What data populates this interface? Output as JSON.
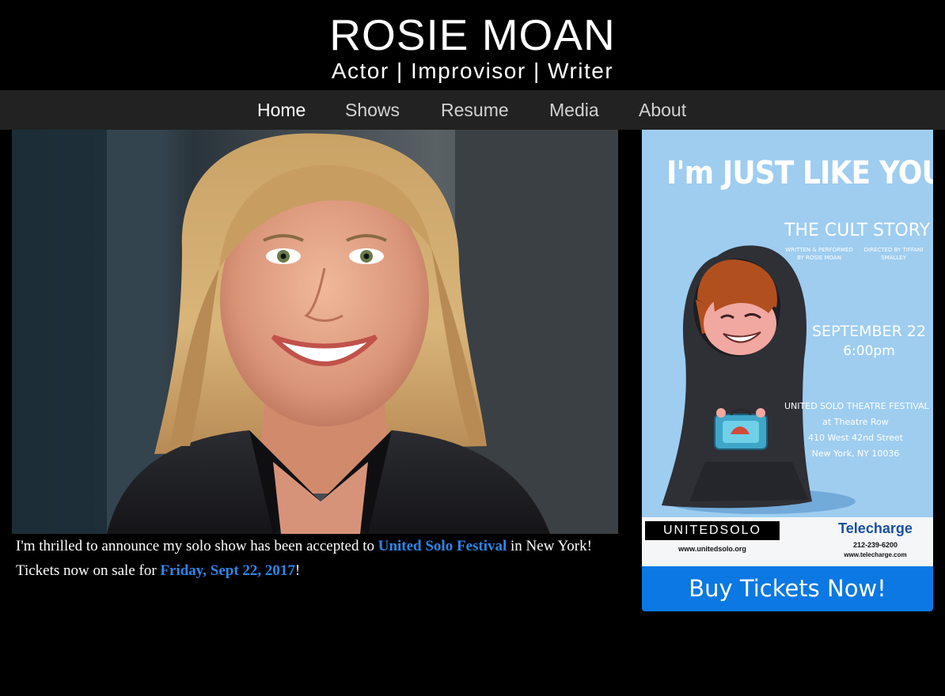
{
  "header": {
    "site_name": "ROSIE MOAN",
    "tagline": "Actor | Improvisor | Writer"
  },
  "nav": {
    "items": [
      {
        "label": "Home",
        "active": true
      },
      {
        "label": "Shows",
        "active": false
      },
      {
        "label": "Resume",
        "active": false
      },
      {
        "label": "Media",
        "active": false
      },
      {
        "label": "About",
        "active": false
      }
    ]
  },
  "announcement": {
    "line1_pre": "I'm thrilled to announce my solo show has been accepted to ",
    "line1_link": "United Solo Festival",
    "line1_post": " in New York!",
    "line2_pre": "Tickets now on sale for ",
    "line2_link": "Friday, Sept 22, 2017",
    "line2_post": "!"
  },
  "poster": {
    "title": "I'm JUST LIKE YOU",
    "subtitle": "THE CULT STORY",
    "credit_left": "WRITTEN & PERFORMED BY ROSIE MOAN",
    "credit_right": "DIRECTED BY TIFFANI SMALLEY",
    "date": "SEPTEMBER 22",
    "time": "6:00pm",
    "venue_lines": [
      "UNITED SOLO THEATRE FESTIVAL",
      "at Theatre Row",
      "410 West 42nd Street",
      "New York, NY 10036"
    ],
    "unitedsolo_logo": "UNITEDSOLO",
    "unitedsolo_url": "www.unitedsolo.org",
    "telecharge_logo": "Telecharge",
    "telecharge_phone": "212-239-6200",
    "telecharge_url": "www.telecharge.com"
  },
  "buy_button": {
    "label": "Buy Tickets Now!",
    "color": "#0b78e3"
  },
  "colors": {
    "background": "#000000",
    "nav_background": "#222222",
    "link": "#2c86e8",
    "poster_background": "#9ecdf0"
  }
}
